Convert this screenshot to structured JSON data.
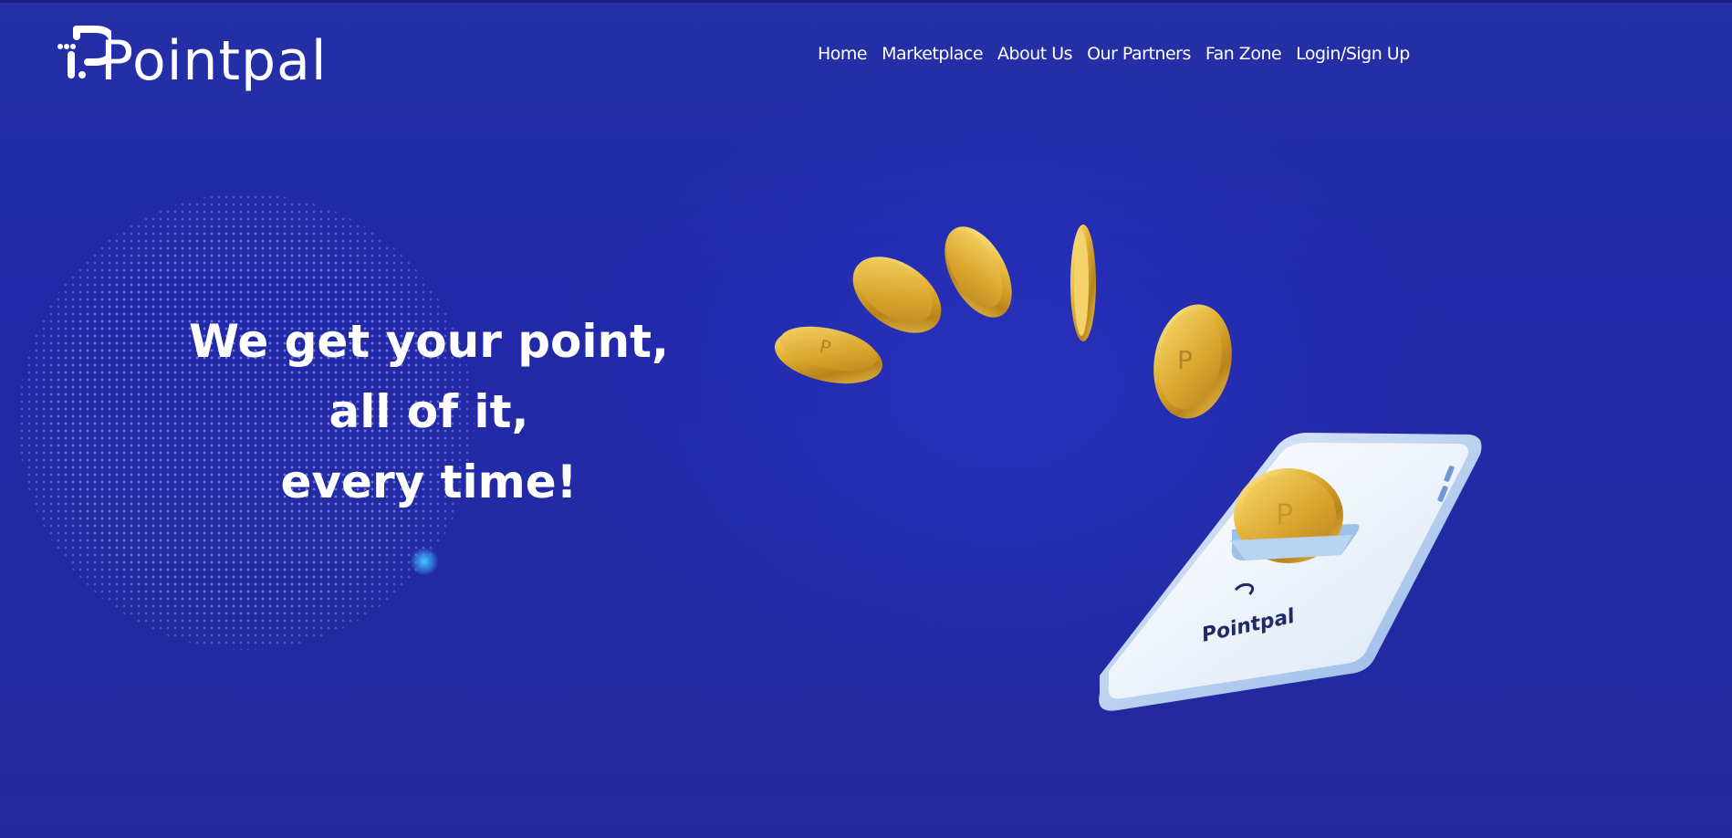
{
  "brand": {
    "name": "Pointpal"
  },
  "nav": {
    "items": [
      {
        "label": "Home"
      },
      {
        "label": "Marketplace"
      },
      {
        "label": "About Us"
      },
      {
        "label": "Our Partners"
      },
      {
        "label": "Fan Zone"
      },
      {
        "label": "Login/Sign Up"
      }
    ]
  },
  "hero": {
    "headline_lines": [
      "We get your point,",
      "all of it,",
      "every time!"
    ],
    "phone_logo_text": "Pointpal"
  },
  "colors": {
    "background": "#2129a8",
    "text": "#ffffff",
    "coin_gold": "#e3b236",
    "phone_body": "#a9c8ee"
  },
  "icons": {
    "logo_mark": "p-circuit-logo-icon",
    "coins": "gold-coin-icon"
  }
}
